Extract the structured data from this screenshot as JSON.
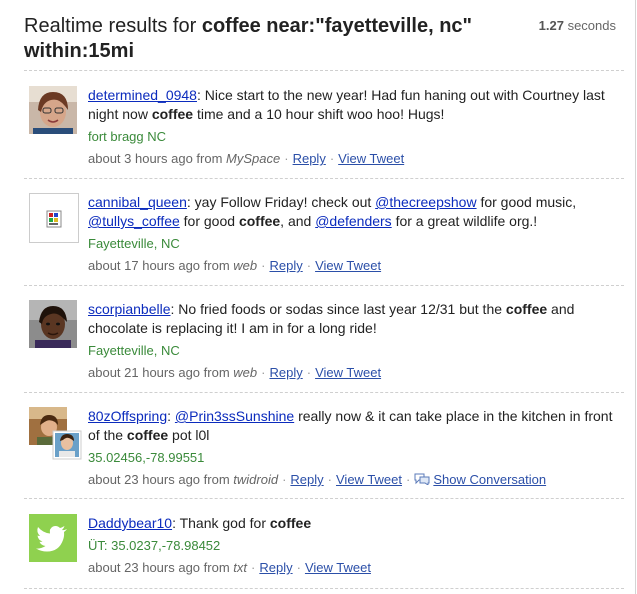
{
  "header": {
    "title_prefix": "Realtime results for ",
    "query": "coffee near:\"fayetteville, nc\" within:15mi",
    "elapsed": "1.27",
    "elapsed_unit": " seconds"
  },
  "tweets": [
    {
      "user": "determined_0948",
      "text_a": ": Nice start to the new year! Had fun haning out with Courtney last night now ",
      "keyword": "coffee",
      "text_b": " time and a 10 hour shift woo hoo! Hugs!",
      "location": "fort bragg NC",
      "time": "about 3 hours ago from ",
      "source": "MySpace",
      "reply": "Reply",
      "view": "View Tweet"
    },
    {
      "user": "cannibal_queen",
      "text_a": ": yay Follow Friday! check out ",
      "mention1": "@thecreepshow",
      "text_b": " for good music, ",
      "mention2": "@tullys_coffee",
      "text_c": " for good ",
      "keyword": "coffee",
      "text_d": ", and ",
      "mention3": "@defenders",
      "text_e": " for a great wildlife org.!",
      "location": "Fayetteville, NC",
      "time": "about 17 hours ago from ",
      "source": "web",
      "reply": "Reply",
      "view": "View Tweet"
    },
    {
      "user": "scorpianbelle",
      "text_a": ": No fried foods or sodas since last year 12/31 but the ",
      "keyword": "coffee",
      "text_b": " and chocolate is replacing it! I am in for a long ride!",
      "location": "Fayetteville, NC",
      "time": "about 21 hours ago from ",
      "source": "web",
      "reply": "Reply",
      "view": "View Tweet"
    },
    {
      "user": "80zOffspring",
      "text_a": ": ",
      "mention1": "@Prin3ssSunshine",
      "text_b": " really now & it can take place in the kitchen in front of the ",
      "keyword": "coffee",
      "text_c": " pot l0l",
      "location": "35.02456,-78.99551",
      "time": "about 23 hours ago from ",
      "source": "twidroid",
      "reply": "Reply",
      "view": "View Tweet",
      "conversation": "Show Conversation"
    },
    {
      "user": "Daddybear10",
      "text_a": ": Thank god for ",
      "keyword": "coffee",
      "location": "ÜT: 35.0237,-78.98452",
      "time": "about 23 hours ago from ",
      "source": "txt",
      "reply": "Reply",
      "view": "View Tweet"
    }
  ],
  "colors": {
    "link": "#0b2bbd",
    "location": "#3a8a3a",
    "meta": "#666666",
    "divider": "#cfcfcf",
    "twitter_bird_bg": "#8fd14f"
  }
}
